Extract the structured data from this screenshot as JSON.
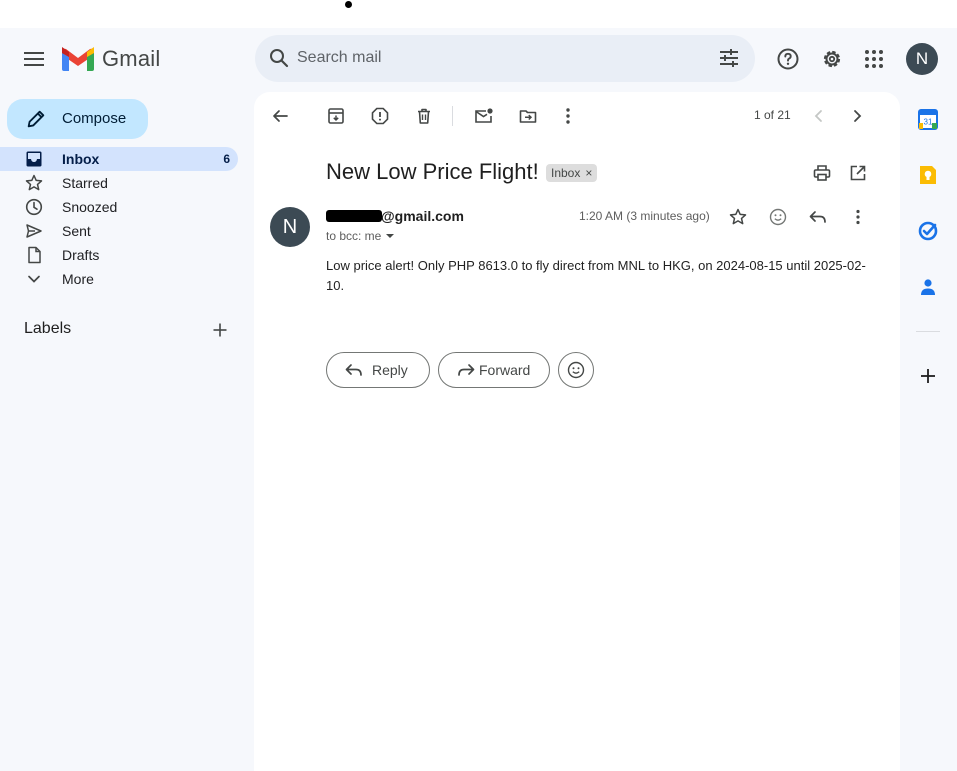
{
  "app": {
    "name": "Gmail"
  },
  "search": {
    "placeholder": "Search mail"
  },
  "account": {
    "initial": "N"
  },
  "nav": {
    "compose_label": "Compose",
    "items": [
      {
        "label": "Inbox",
        "count": "6",
        "icon": "inbox-icon",
        "active": true
      },
      {
        "label": "Starred",
        "count": "",
        "icon": "star-icon"
      },
      {
        "label": "Snoozed",
        "count": "",
        "icon": "clock-icon"
      },
      {
        "label": "Sent",
        "count": "",
        "icon": "send-icon"
      },
      {
        "label": "Drafts",
        "count": "",
        "icon": "draft-icon"
      },
      {
        "label": "More",
        "count": "",
        "icon": "chevron-down-icon"
      }
    ],
    "labels_heading": "Labels"
  },
  "toolbar": {
    "pager": "1 of 21"
  },
  "message": {
    "subject": "New Low Price Flight!",
    "label_chip": "Inbox",
    "sender_initial": "N",
    "sender_email": "@gmail.com",
    "to_line": "to bcc: me",
    "time": "1:20 AM (3 minutes ago)",
    "body": "Low price alert! Only PHP 8613.0 to fly direct from MNL to HKG, on 2024-08-15 until 2025-02-10."
  },
  "actions": {
    "reply_label": "Reply",
    "forward_label": "Forward"
  },
  "colors": {
    "accent": "#0b57d0",
    "compose_bg": "#c2e7ff",
    "active_nav_bg": "#d3e3fd",
    "avatar_bg": "#3c4a54"
  },
  "side_panel": {
    "apps": [
      "calendar-icon",
      "keep-icon",
      "tasks-icon",
      "contacts-icon"
    ],
    "calendar_day": "31"
  }
}
